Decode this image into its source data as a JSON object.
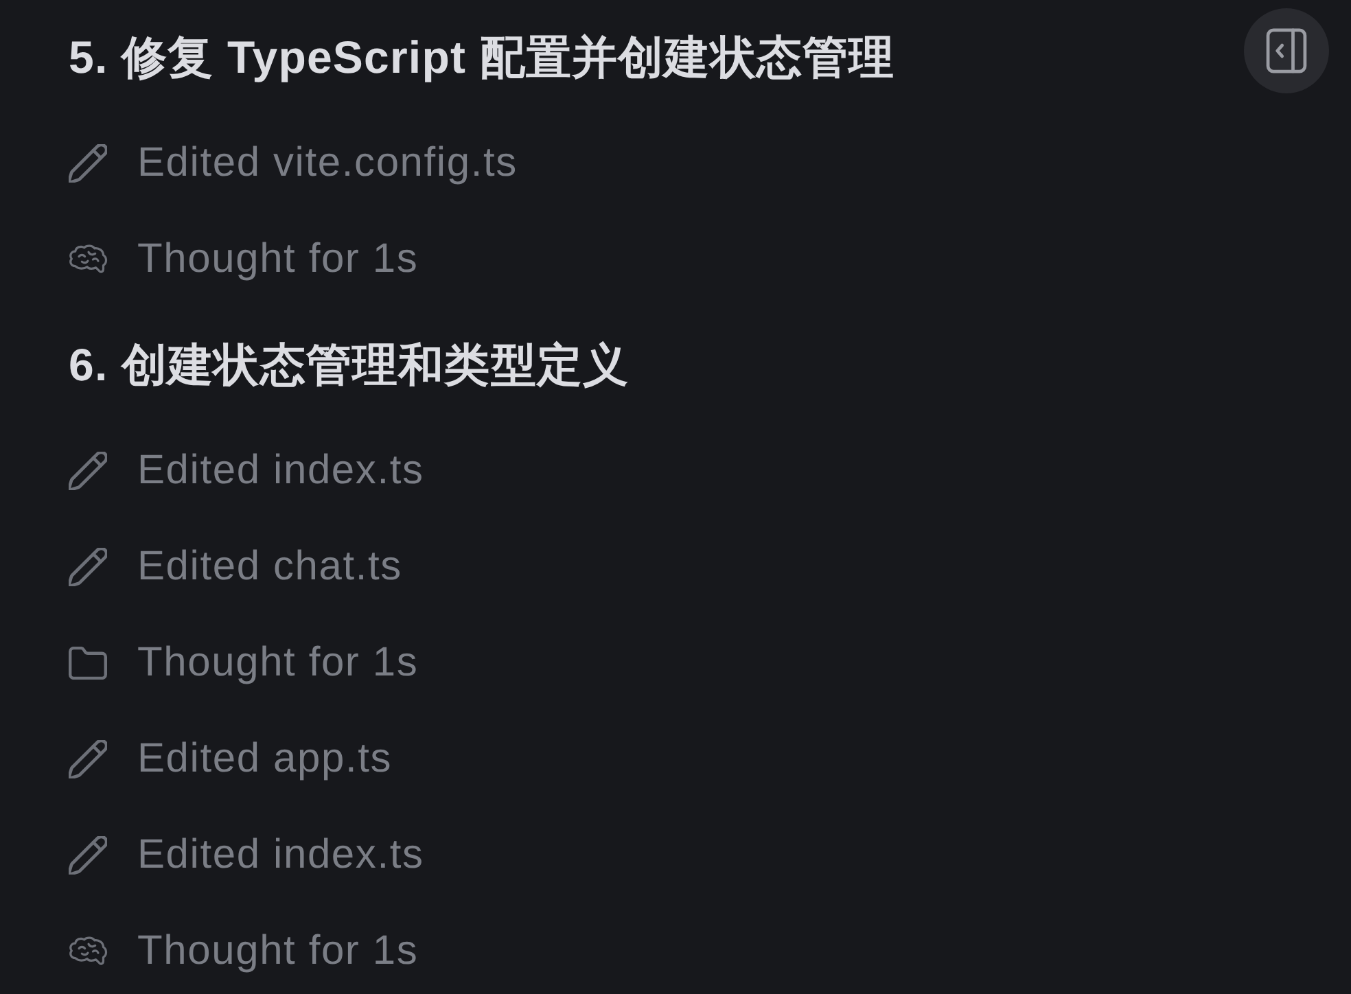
{
  "sections": [
    {
      "title": "5. 修复 TypeScript 配置并创建状态管理",
      "steps": [
        {
          "kind": "edit",
          "text": "Edited vite.config.ts"
        },
        {
          "kind": "thinking",
          "text": "Thought for 1s"
        }
      ]
    },
    {
      "title": "6. 创建状态管理和类型定义",
      "steps": [
        {
          "kind": "edit",
          "text": "Edited index.ts"
        },
        {
          "kind": "edit",
          "text": "Edited chat.ts"
        },
        {
          "kind": "listing",
          "text": "Thought for 1s"
        },
        {
          "kind": "edit",
          "text": "Edited app.ts"
        },
        {
          "kind": "edit",
          "text": "Edited index.ts"
        },
        {
          "kind": "thinking",
          "text": "Thought for 1s"
        }
      ]
    }
  ]
}
